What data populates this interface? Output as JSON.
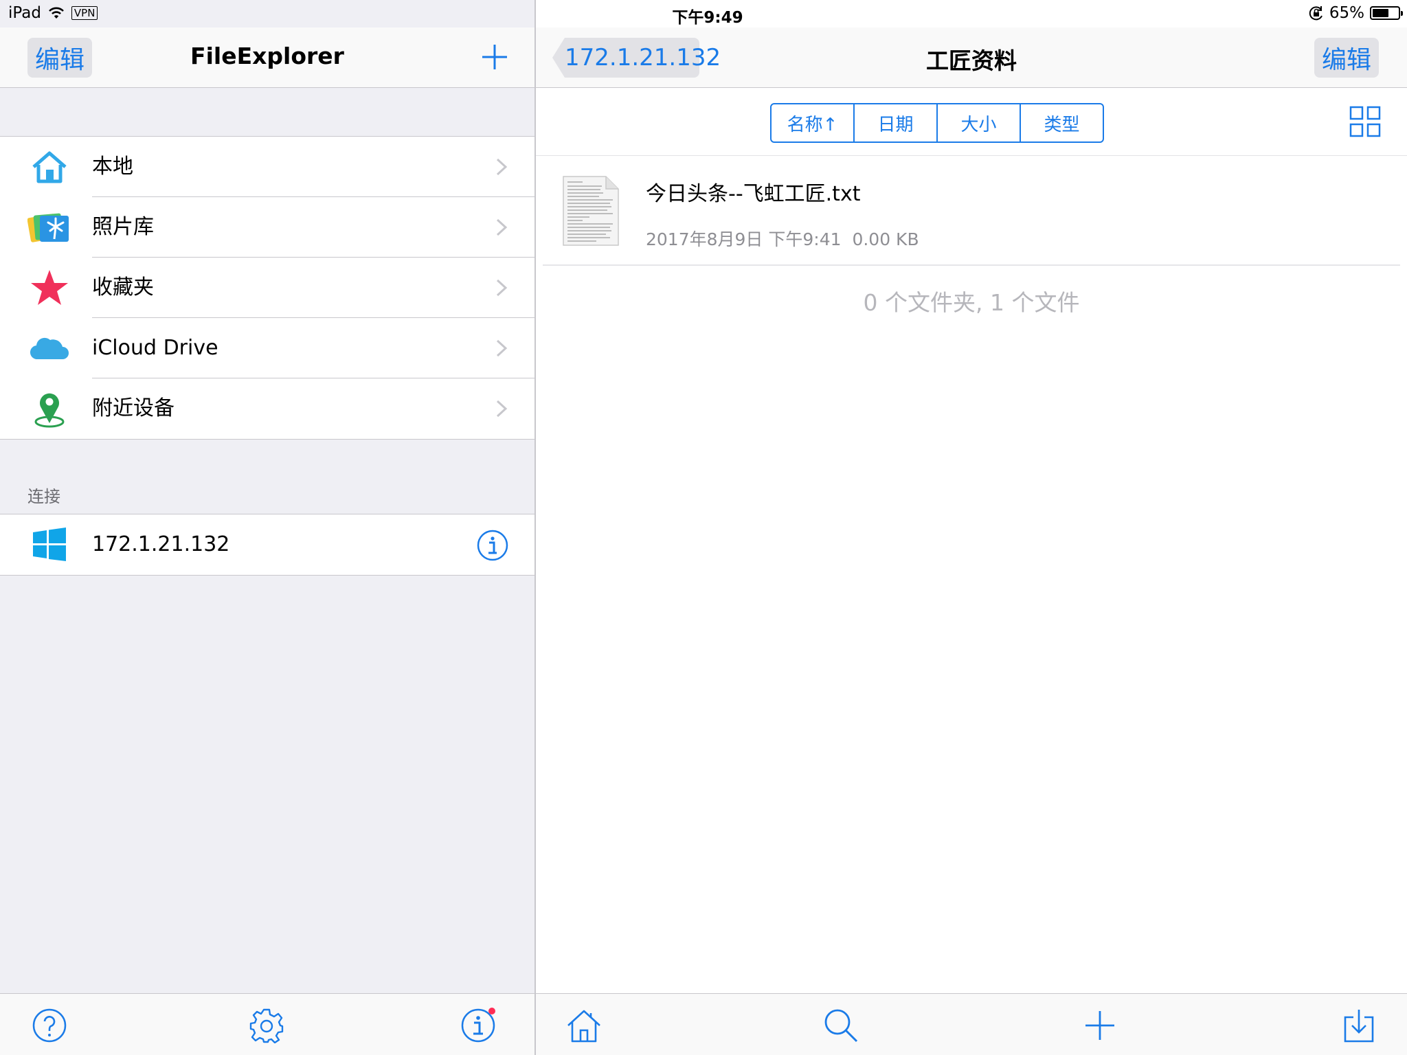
{
  "status_bar": {
    "device": "iPad",
    "vpn": "VPN",
    "time": "下午9:49",
    "battery": "65%",
    "battery_level": 0.65
  },
  "master": {
    "edit_label": "编辑",
    "title": "FileExplorer",
    "add_icon": "plus-icon",
    "locations": [
      {
        "label": "本地",
        "icon": "home-icon"
      },
      {
        "label": "照片库",
        "icon": "photos-icon"
      },
      {
        "label": "收藏夹",
        "icon": "star-icon"
      },
      {
        "label": "iCloud Drive",
        "icon": "cloud-icon"
      },
      {
        "label": "附近设备",
        "icon": "location-pin-icon"
      }
    ],
    "connections_header": "连接",
    "connections": [
      {
        "label": "172.1.21.132",
        "icon": "windows-icon"
      }
    ],
    "toolbar": [
      "help-icon",
      "settings-icon",
      "info-icon"
    ]
  },
  "detail": {
    "back_label": "172.1.21.132",
    "title": "工匠资料",
    "edit_label": "编辑",
    "sort_options": [
      "名称↑",
      "日期",
      "大小",
      "类型"
    ],
    "files": [
      {
        "name": "今日头条--飞虹工匠.txt",
        "date": "2017年8月9日 下午9:41",
        "size": "0.00 KB"
      }
    ],
    "summary": "0 个文件夹, 1 个文件",
    "toolbar": [
      "home-icon",
      "search-icon",
      "plus-icon",
      "download-icon"
    ]
  },
  "colors": {
    "accent": "#1a7be8",
    "background_grouped": "#efeff4",
    "separator": "#c8c7cc",
    "star": "#f0305a",
    "badge": "#ff2d55"
  }
}
